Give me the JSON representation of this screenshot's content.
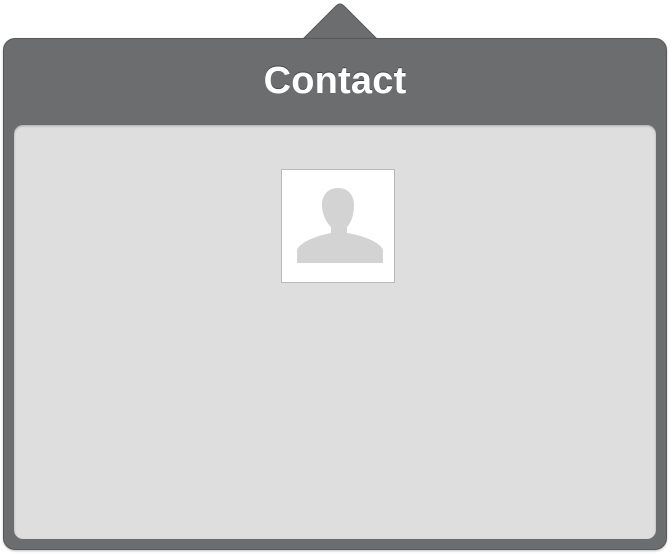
{
  "popover": {
    "title": "Contact"
  },
  "contact": {
    "avatar_icon": "person-silhouette-icon"
  },
  "colors": {
    "chrome": "#6c6d6f",
    "content_background": "#dedede",
    "avatar_background": "#ffffff",
    "silhouette": "#d3d3d3"
  }
}
